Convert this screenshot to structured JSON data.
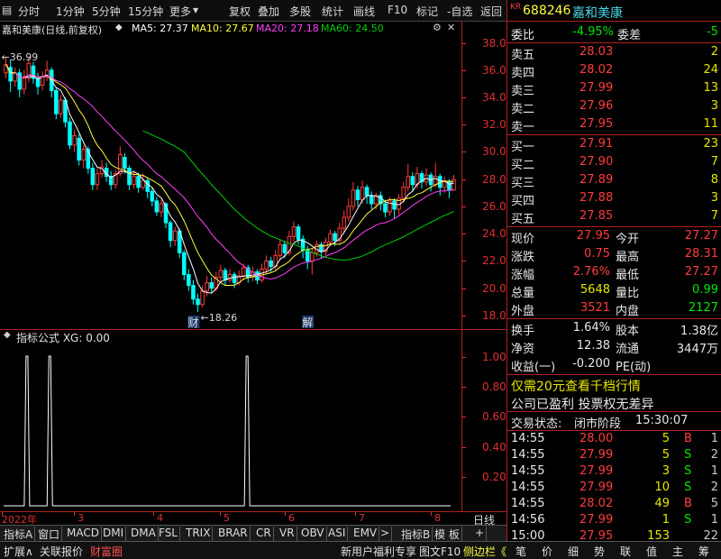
{
  "toolbar": {
    "items": [
      "分时",
      "1分钟",
      "5分钟",
      "15分钟",
      "更多"
    ],
    "right_items": [
      "复权",
      "叠加",
      "多股",
      "统计",
      "画线",
      "F10",
      "标记",
      "-自选",
      "返回"
    ]
  },
  "chart_header": {
    "title": "嘉和美康(日线,前复权)",
    "ma5": "MA5: 27.37",
    "ma10": "MA10: 27.67",
    "ma20": "MA20: 27.18",
    "ma60": "MA60: 24.50"
  },
  "colors": {
    "up": "#ff3c3c",
    "down": "#00ffff",
    "ma5": "#ffffff",
    "ma10": "#ffff40",
    "ma20": "#ff40ff",
    "ma60": "#00d000",
    "axis": "#e03030",
    "frame": "#b02020"
  },
  "price_axis": [
    "38.00",
    "36.00",
    "34.00",
    "32.00",
    "30.00",
    "28.00",
    "26.00",
    "24.00",
    "22.00",
    "20.00",
    "18.00"
  ],
  "price_annotations": {
    "high": "36.99",
    "low": "18.26",
    "high_arrow": "←",
    "low_arrow": "←",
    "marker_cai": "财",
    "marker_jie": "解"
  },
  "indicator": {
    "header": "指标公式 XG: 0.00",
    "axis": [
      "1.00",
      "0.80",
      "0.60",
      "0.40",
      "0.20"
    ]
  },
  "date_axis": [
    "2022年",
    "3",
    "4",
    "5",
    "6",
    "7",
    "8"
  ],
  "day_button": "日线",
  "indicator_tabs": [
    "指标A",
    "窗口",
    "MACD",
    "DMI",
    "DMA",
    "FSL",
    "TRIX",
    "BRAR",
    "CR",
    "VR",
    "OBV",
    "ASI",
    "EMV",
    ">",
    "指标B",
    "模 板",
    "+"
  ],
  "bottom_bar": {
    "left": [
      "扩展∧",
      "关联报价",
      "财富圈"
    ],
    "right": [
      "新用户福利专享",
      "图文F10",
      "侧边栏《"
    ],
    "tabs": [
      "笔",
      "价",
      "细",
      "势",
      "联",
      "值",
      "主",
      "筹"
    ]
  },
  "stock": {
    "badge": "KR",
    "code": "688246",
    "name": "嘉和美康"
  },
  "weibi": {
    "label": "委比",
    "value": "-4.95%",
    "diff_label": "委差",
    "diff": "-5"
  },
  "asks": [
    {
      "label": "卖五",
      "price": "28.03",
      "vol": "2"
    },
    {
      "label": "卖四",
      "price": "28.02",
      "vol": "24"
    },
    {
      "label": "卖三",
      "price": "27.99",
      "vol": "13"
    },
    {
      "label": "卖二",
      "price": "27.96",
      "vol": "3"
    },
    {
      "label": "卖一",
      "price": "27.95",
      "vol": "11"
    }
  ],
  "bids": [
    {
      "label": "买一",
      "price": "27.91",
      "vol": "23"
    },
    {
      "label": "买二",
      "price": "27.90",
      "vol": "7"
    },
    {
      "label": "买三",
      "price": "27.89",
      "vol": "8"
    },
    {
      "label": "买四",
      "price": "27.88",
      "vol": "3"
    },
    {
      "label": "买五",
      "price": "27.85",
      "vol": "7"
    }
  ],
  "quote": [
    {
      "l1": "现价",
      "v1": "27.95",
      "c1": "red",
      "l2": "今开",
      "v2": "27.27",
      "c2": "red"
    },
    {
      "l1": "涨跌",
      "v1": "0.75",
      "c1": "red",
      "l2": "最高",
      "v2": "28.31",
      "c2": "red"
    },
    {
      "l1": "涨幅",
      "v1": "2.76%",
      "c1": "red",
      "l2": "最低",
      "v2": "27.27",
      "c2": "red"
    },
    {
      "l1": "总量",
      "v1": "5648",
      "c1": "yel",
      "l2": "量比",
      "v2": "0.99",
      "c2": "green"
    },
    {
      "l1": "外盘",
      "v1": "3521",
      "c1": "red",
      "l2": "内盘",
      "v2": "2127",
      "c2": "green"
    }
  ],
  "fin": [
    {
      "l1": "换手",
      "v1": "1.64%",
      "l2": "股本",
      "v2": "1.38亿"
    },
    {
      "l1": "净资",
      "v1": "12.38",
      "l2": "流通",
      "v2": "3447万"
    },
    {
      "l1": "收益(一)",
      "v1": "-0.200",
      "l2": "PE(动)",
      "v2": ""
    }
  ],
  "promo": "仅需20元查看千档行情",
  "info": "公司已盈利 投票权无差异",
  "trade_status": {
    "label": "交易状态:",
    "value": "闭市阶段",
    "time": "15:30:07"
  },
  "ticks": [
    {
      "time": "14:55",
      "price": "28.00",
      "vol": "5",
      "side": "B",
      "count": "1"
    },
    {
      "time": "14:55",
      "price": "27.99",
      "vol": "5",
      "side": "S",
      "count": "2"
    },
    {
      "time": "14:55",
      "price": "27.99",
      "vol": "3",
      "side": "S",
      "count": "1"
    },
    {
      "time": "14:55",
      "price": "27.99",
      "vol": "10",
      "side": "S",
      "count": "2"
    },
    {
      "time": "14:55",
      "price": "28.02",
      "vol": "49",
      "side": "B",
      "count": "5"
    },
    {
      "time": "14:56",
      "price": "27.99",
      "vol": "1",
      "side": "S",
      "count": "1"
    },
    {
      "time": "15:00",
      "price": "27.95",
      "vol": "153",
      "side": "",
      "count": "22"
    }
  ],
  "chart_data": {
    "type": "candlestick",
    "period": "daily",
    "price_range": [
      17,
      38.5
    ],
    "candles": [
      [
        35.8,
        36.4,
        37.0,
        35.4
      ],
      [
        36.2,
        35.2,
        36.8,
        34.4
      ],
      [
        35.2,
        35.8,
        36.2,
        34.8
      ],
      [
        35.8,
        34.6,
        36.1,
        34.0
      ],
      [
        34.6,
        35.4,
        36.0,
        34.2
      ],
      [
        35.4,
        36.5,
        36.99,
        35.1
      ],
      [
        36.3,
        35.4,
        36.6,
        35.0
      ],
      [
        35.4,
        34.8,
        35.8,
        34.2
      ],
      [
        34.9,
        35.5,
        35.9,
        34.5
      ],
      [
        35.5,
        36.0,
        36.7,
        35.2
      ],
      [
        36.0,
        34.5,
        36.2,
        34.0
      ],
      [
        34.5,
        32.8,
        34.7,
        32.4
      ],
      [
        32.8,
        33.8,
        34.2,
        32.5
      ],
      [
        33.8,
        32.2,
        34.0,
        31.8
      ],
      [
        32.2,
        30.5,
        32.5,
        30.2
      ],
      [
        30.5,
        31.2,
        31.6,
        30.0
      ],
      [
        31.0,
        29.4,
        31.3,
        29.0
      ],
      [
        29.4,
        30.2,
        30.5,
        28.8
      ],
      [
        30.2,
        28.8,
        30.4,
        28.4
      ],
      [
        28.8,
        27.6,
        29.2,
        27.2
      ],
      [
        27.6,
        28.4,
        28.8,
        27.2
      ],
      [
        28.4,
        28.9,
        29.4,
        28.1
      ],
      [
        28.8,
        28.2,
        29.2,
        27.8
      ],
      [
        28.2,
        27.6,
        28.6,
        27.2
      ],
      [
        27.6,
        28.4,
        28.7,
        27.3
      ],
      [
        28.4,
        29.8,
        30.4,
        28.2
      ],
      [
        29.6,
        28.8,
        29.9,
        28.4
      ],
      [
        28.8,
        27.6,
        29.0,
        27.2
      ],
      [
        27.6,
        28.2,
        28.6,
        27.3
      ],
      [
        28.2,
        27.4,
        28.5,
        27.0
      ],
      [
        27.4,
        27.9,
        28.4,
        27.2
      ],
      [
        27.9,
        27.1,
        28.1,
        26.6
      ],
      [
        27.1,
        26.4,
        27.4,
        26.0
      ],
      [
        26.4,
        25.6,
        26.7,
        25.3
      ],
      [
        25.6,
        26.2,
        26.5,
        25.2
      ],
      [
        26.2,
        24.8,
        26.3,
        24.4
      ],
      [
        24.8,
        23.5,
        25.0,
        23.0
      ],
      [
        23.5,
        24.2,
        24.5,
        23.1
      ],
      [
        24.2,
        22.6,
        24.4,
        22.2
      ],
      [
        22.6,
        21.0,
        22.8,
        20.6
      ],
      [
        21.0,
        20.2,
        21.4,
        19.8
      ],
      [
        20.2,
        19.2,
        20.6,
        18.8
      ],
      [
        19.2,
        18.8,
        19.6,
        18.26
      ],
      [
        18.8,
        19.8,
        20.2,
        18.6
      ],
      [
        19.8,
        20.4,
        20.9,
        19.4
      ],
      [
        20.4,
        20.0,
        20.8,
        19.6
      ],
      [
        20.0,
        20.8,
        21.2,
        19.8
      ],
      [
        20.8,
        21.3,
        21.7,
        20.5
      ],
      [
        21.3,
        20.6,
        21.5,
        20.2
      ],
      [
        20.6,
        21.0,
        21.4,
        20.4
      ],
      [
        21.0,
        20.4,
        21.2,
        20.0
      ],
      [
        20.4,
        20.9,
        21.3,
        20.2
      ],
      [
        20.9,
        21.5,
        21.8,
        20.6
      ],
      [
        21.5,
        20.8,
        21.7,
        20.4
      ],
      [
        20.8,
        21.2,
        21.6,
        20.5
      ],
      [
        21.2,
        20.6,
        21.4,
        20.3
      ],
      [
        20.6,
        21.4,
        21.8,
        20.4
      ],
      [
        21.4,
        22.0,
        22.4,
        21.1
      ],
      [
        22.0,
        21.6,
        22.3,
        21.2
      ],
      [
        21.6,
        22.4,
        22.8,
        21.4
      ],
      [
        22.4,
        23.2,
        23.6,
        22.1
      ],
      [
        23.2,
        22.6,
        23.5,
        22.2
      ],
      [
        22.6,
        23.8,
        24.2,
        22.4
      ],
      [
        23.8,
        24.5,
        24.9,
        23.4
      ],
      [
        24.5,
        23.6,
        24.7,
        23.2
      ],
      [
        23.6,
        22.8,
        23.9,
        22.2
      ],
      [
        22.8,
        22.0,
        23.1,
        21.4
      ],
      [
        22.0,
        22.6,
        22.9,
        21.0
      ],
      [
        22.6,
        23.2,
        23.5,
        22.3
      ],
      [
        23.2,
        22.7,
        23.4,
        22.2
      ],
      [
        22.7,
        23.4,
        23.7,
        22.4
      ],
      [
        23.4,
        24.0,
        24.3,
        23.1
      ],
      [
        24.0,
        23.5,
        24.2,
        23.1
      ],
      [
        23.5,
        24.4,
        24.8,
        23.3
      ],
      [
        24.4,
        25.2,
        25.7,
        24.1
      ],
      [
        25.2,
        26.0,
        26.6,
        24.9
      ],
      [
        26.0,
        27.2,
        27.8,
        25.7
      ],
      [
        27.2,
        26.5,
        27.5,
        26.0
      ],
      [
        26.5,
        27.4,
        27.9,
        26.2
      ],
      [
        27.4,
        26.8,
        27.6,
        26.2
      ],
      [
        26.8,
        26.2,
        27.1,
        25.8
      ],
      [
        26.2,
        26.8,
        27.0,
        25.8
      ],
      [
        26.8,
        26.2,
        27.1,
        25.7
      ],
      [
        26.2,
        25.6,
        26.5,
        25.2
      ],
      [
        25.6,
        26.4,
        26.7,
        25.3
      ],
      [
        26.4,
        25.8,
        26.6,
        25.1
      ],
      [
        25.8,
        26.6,
        26.9,
        25.4
      ],
      [
        26.6,
        27.4,
        27.8,
        26.3
      ],
      [
        27.4,
        28.2,
        29.1,
        27.1
      ],
      [
        28.2,
        27.6,
        28.5,
        27.1
      ],
      [
        27.6,
        28.4,
        28.9,
        27.3
      ],
      [
        28.4,
        27.8,
        28.6,
        27.3
      ],
      [
        27.8,
        28.3,
        28.8,
        27.5
      ],
      [
        28.3,
        27.6,
        28.5,
        27.1
      ],
      [
        27.6,
        28.2,
        29.2,
        27.4
      ],
      [
        28.2,
        27.4,
        28.4,
        26.8
      ],
      [
        27.4,
        27.8,
        28.2,
        27.0
      ],
      [
        27.8,
        27.2,
        28.0,
        26.6
      ],
      [
        27.2,
        27.95,
        28.31,
        27.27
      ]
    ],
    "ma_last": {
      "MA5": 27.37,
      "MA10": 27.67,
      "MA20": 27.18,
      "MA60": 24.5
    },
    "xg_signal_days": [
      5,
      10,
      51
    ]
  }
}
